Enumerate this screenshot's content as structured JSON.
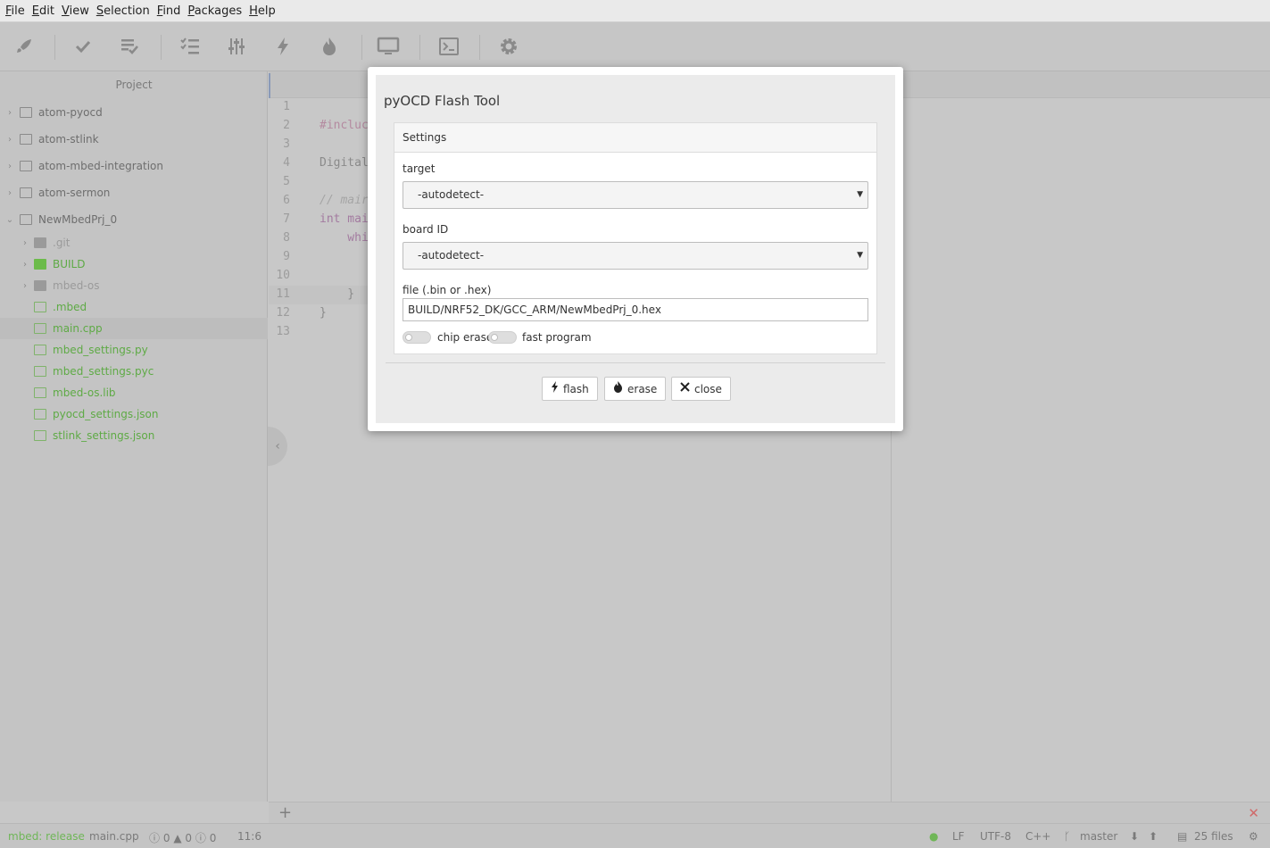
{
  "menubar": {
    "items": [
      {
        "label": "File",
        "key": "F",
        "rest": "ile"
      },
      {
        "label": "Edit",
        "key": "E",
        "rest": "dit"
      },
      {
        "label": "View",
        "key": "V",
        "rest": "iew"
      },
      {
        "label": "Selection",
        "key": "S",
        "rest": "election"
      },
      {
        "label": "Find",
        "key": "F",
        "rest": "ind"
      },
      {
        "label": "Packages",
        "key": "P",
        "rest": "ackages"
      },
      {
        "label": "Help",
        "key": "H",
        "rest": "elp"
      }
    ]
  },
  "toolbar": {
    "icons": [
      "rocket-icon",
      "check-icon",
      "checklist-icon",
      "tasks-icon",
      "sliders-icon",
      "bolt-icon",
      "fire-icon",
      "monitor-icon",
      "terminal-icon",
      "gear-icon"
    ]
  },
  "tree": {
    "header": "Project",
    "roots": [
      {
        "label": "atom-pyocd"
      },
      {
        "label": "atom-stlink"
      },
      {
        "label": "atom-mbed-integration"
      },
      {
        "label": "atom-sermon"
      },
      {
        "label": "NewMbedPrj_0"
      }
    ],
    "children": [
      {
        "label": ".git"
      },
      {
        "label": "BUILD"
      },
      {
        "label": "mbed-os"
      },
      {
        "label": ".mbed"
      },
      {
        "label": "main.cpp"
      },
      {
        "label": "mbed_settings.py"
      },
      {
        "label": "mbed_settings.pyc"
      },
      {
        "label": "mbed-os.lib"
      },
      {
        "label": "pyocd_settings.json"
      },
      {
        "label": "stlink_settings.json"
      }
    ]
  },
  "editor": {
    "line_numbers": [
      "1",
      "2",
      "3",
      "4",
      "5",
      "6",
      "7",
      "8",
      "9",
      "10",
      "11",
      "12",
      "13"
    ],
    "lines": {
      "l2": "#incluc",
      "l4": "Digital",
      "l6": "// mair",
      "l7_kw": "int",
      "l7_rest": " mai",
      "l8": "    whi",
      "l11": "    }",
      "l12": "}"
    }
  },
  "dialog": {
    "title": "pyOCD Flash Tool",
    "settings_header": "Settings",
    "target_label": "target",
    "target_value": "-autodetect-",
    "board_label": "board ID",
    "board_value": "-autodetect-",
    "file_label": "file (.bin or .hex)",
    "file_value": "BUILD/NRF52_DK/GCC_ARM/NewMbedPrj_0.hex",
    "chip_erase_label": "chip erase",
    "fast_program_label": "fast program",
    "flash_label": "flash",
    "erase_label": "erase",
    "close_label": "close"
  },
  "status": {
    "mbed": "mbed: release",
    "file": "main.cpp",
    "err_count": "0",
    "warn_count": "0",
    "info_count": "0",
    "cursor": "11:6",
    "line_ending": "LF",
    "encoding": "UTF-8",
    "grammar": "C++",
    "branch": "master",
    "files": "25 files"
  },
  "colors": {
    "accent_green": "#5eaa45",
    "close_red": "#d06a6a"
  }
}
